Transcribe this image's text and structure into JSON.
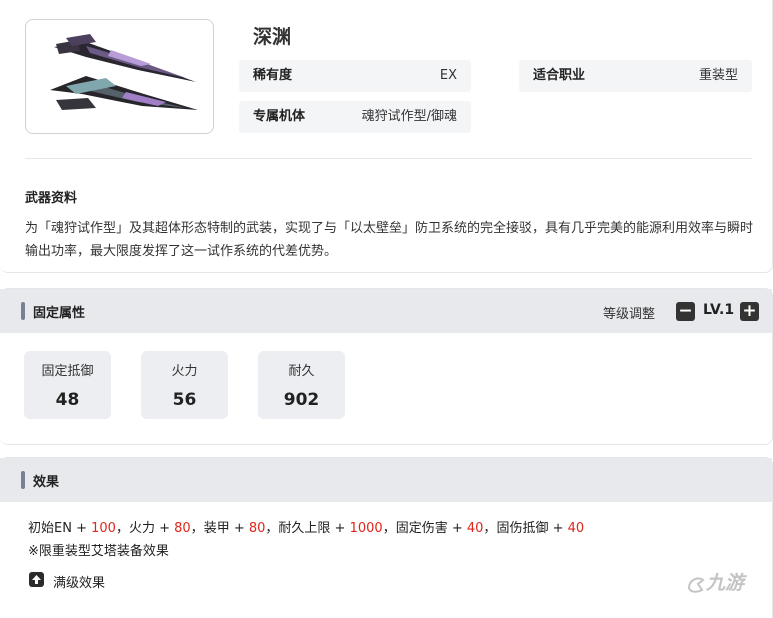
{
  "weapon": {
    "name": "深渊",
    "rarity_label": "稀有度",
    "rarity_value": "EX",
    "class_label": "适合职业",
    "class_value": "重装型",
    "exclusive_label": "专属机体",
    "exclusive_value": "魂狩试作型/御魂"
  },
  "info": {
    "title": "武器资料",
    "description": "为「魂狩试作型」及其超体形态特制的武装，实现了与「以太壁垒」防卫系统的完全接驳，具有几乎完美的能源利用效率与瞬时输出功率，最大限度发挥了这一试作系统的代差优势。"
  },
  "fixed_stats": {
    "title": "固定属性",
    "level_label": "等级调整",
    "level_value": "LV.1",
    "minus_icon": "minus-icon",
    "plus_icon": "plus-icon",
    "items": [
      {
        "name": "固定抵御",
        "value": "48"
      },
      {
        "name": "火力",
        "value": "56"
      },
      {
        "name": "耐久",
        "value": "902"
      }
    ]
  },
  "effect": {
    "title": "效果",
    "segments": [
      {
        "label": "初始EN + ",
        "value": "100",
        "sep": "，"
      },
      {
        "label": "火力 + ",
        "value": "80",
        "sep": "，"
      },
      {
        "label": "装甲 + ",
        "value": "80",
        "sep": "，"
      },
      {
        "label": "耐久上限 + ",
        "value": "1000",
        "sep": "，"
      },
      {
        "label": "固定伤害 + ",
        "value": "40",
        "sep": "，"
      },
      {
        "label": "固伤抵御 + ",
        "value": "40",
        "sep": ""
      }
    ],
    "note": "※限重装型艾塔装备效果",
    "max_label": "满级效果"
  },
  "watermark": "九游",
  "colors": {
    "accent_bar": "#7a8194",
    "highlight": "#e1251b",
    "header_bg": "#e8e9ec"
  }
}
